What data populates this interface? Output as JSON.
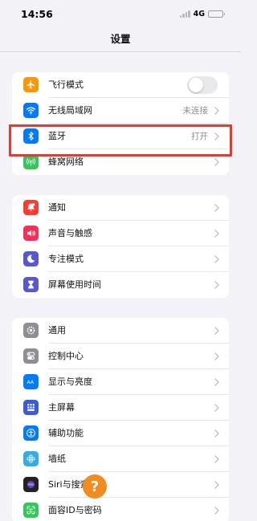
{
  "status_bar": {
    "time": "14:56",
    "network": "4G",
    "battery_level": 0.9
  },
  "nav": {
    "title": "设置"
  },
  "groups": [
    {
      "items": [
        {
          "label": "飞行模式",
          "icon": "airplane-icon",
          "color": "#ff9500",
          "accessory": "toggle",
          "toggle_on": false
        },
        {
          "label": "无线局域网",
          "icon": "wifi-icon",
          "color": "#007aff",
          "value": "未连接",
          "accessory": "chevron"
        },
        {
          "label": "蓝牙",
          "icon": "bluetooth-icon",
          "color": "#007aff",
          "value": "打开",
          "accessory": "chevron"
        },
        {
          "label": "蜂窝网络",
          "icon": "cellular-icon",
          "color": "#34c759",
          "accessory": "chevron",
          "highlighted": true
        }
      ]
    },
    {
      "items": [
        {
          "label": "通知",
          "icon": "notifications-icon",
          "color": "#ff3b30"
        },
        {
          "label": "声音与触感",
          "icon": "speaker-icon",
          "color": "#ff2d55"
        },
        {
          "label": "专注模式",
          "icon": "moon-icon",
          "color": "#5856d6"
        },
        {
          "label": "屏幕使用时间",
          "icon": "hourglass-icon",
          "color": "#5856d6"
        }
      ]
    },
    {
      "items": [
        {
          "label": "通用",
          "icon": "gear-icon",
          "color": "#8e8e93"
        },
        {
          "label": "控制中心",
          "icon": "control-center-icon",
          "color": "#8e8e93"
        },
        {
          "label": "显示与亮度",
          "icon": "display-icon",
          "color": "#007aff"
        },
        {
          "label": "主屏幕",
          "icon": "home-screen-icon",
          "color": "#3b5bdb"
        },
        {
          "label": "辅助功能",
          "icon": "accessibility-icon",
          "color": "#007aff"
        },
        {
          "label": "墙纸",
          "icon": "wallpaper-icon",
          "color": "#32ade6"
        },
        {
          "label": "Siri与搜索",
          "icon": "siri-icon",
          "color": "#222222"
        },
        {
          "label": "面容ID与密码",
          "icon": "face-id-icon",
          "color": "#34c759"
        }
      ]
    }
  ],
  "overlay": {
    "help_badge": "?"
  }
}
